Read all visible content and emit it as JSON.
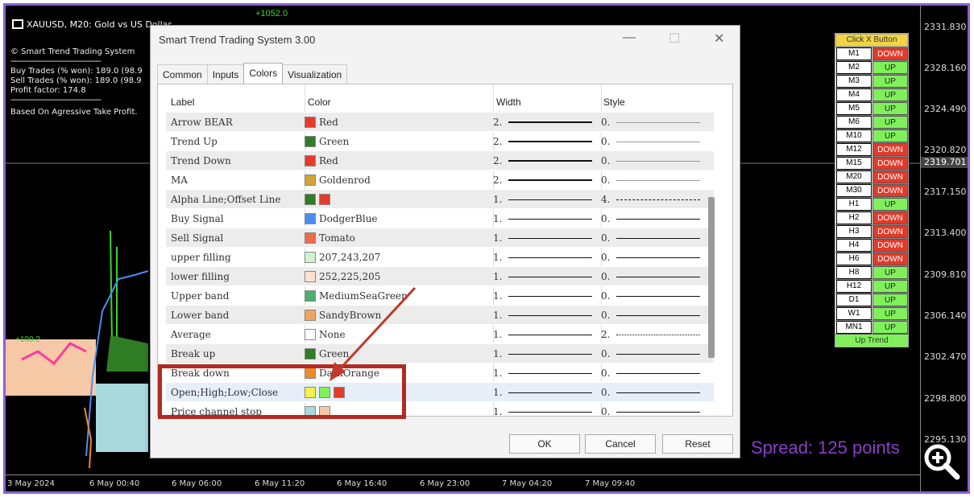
{
  "chart": {
    "symbol_title": "XAUUSD, M20:  Gold vs US Dollar",
    "top_label": "+1052.0",
    "info_lines": [
      "© Smart Trend Trading System",
      "Buy Trades (% won): 189.0 (98.9",
      "Sell Trades (% won): 189.0 (98.9",
      "Profit factor: 174.8",
      "Based On Agressive Take Profit."
    ],
    "small_label": "+100.2",
    "price_ticks": [
      "2331.830",
      "2328.160",
      "2324.490",
      "2320.820",
      "2317.150",
      "2313.400",
      "2309.810",
      "2306.140",
      "2302.470",
      "2298.800",
      "2295.130"
    ],
    "current_price": "2319.701",
    "time_ticks": [
      "3 May 2024",
      "6 May 00:40",
      "6 May 06:00",
      "6 May 11:20",
      "6 May 16:40",
      "6 May 23:00",
      "7 May 04:20",
      "7 May 09:40"
    ],
    "spread": "Spread: 125 points",
    "colors": {
      "bullish": "#3bd42a",
      "bearish": "#e33a2a",
      "band": "#a9d9dc",
      "peach": "#f6c9a6"
    }
  },
  "tf_panel": {
    "header": "Click X Button",
    "rows": [
      {
        "tf": "M1",
        "state": "DOWN"
      },
      {
        "tf": "M2",
        "state": "UP"
      },
      {
        "tf": "M3",
        "state": "UP"
      },
      {
        "tf": "M4",
        "state": "UP"
      },
      {
        "tf": "M5",
        "state": "UP"
      },
      {
        "tf": "M6",
        "state": "UP"
      },
      {
        "tf": "M10",
        "state": "UP"
      },
      {
        "tf": "M12",
        "state": "DOWN"
      },
      {
        "tf": "M15",
        "state": "DOWN"
      },
      {
        "tf": "M20",
        "state": "DOWN"
      },
      {
        "tf": "M30",
        "state": "DOWN"
      },
      {
        "tf": "H1",
        "state": "UP"
      },
      {
        "tf": "H2",
        "state": "DOWN"
      },
      {
        "tf": "H3",
        "state": "DOWN"
      },
      {
        "tf": "H4",
        "state": "DOWN"
      },
      {
        "tf": "H6",
        "state": "DOWN"
      },
      {
        "tf": "H8",
        "state": "UP"
      },
      {
        "tf": "H12",
        "state": "UP"
      },
      {
        "tf": "D1",
        "state": "UP"
      },
      {
        "tf": "W1",
        "state": "UP"
      },
      {
        "tf": "MN1",
        "state": "UP"
      }
    ],
    "footer": "Up Trend"
  },
  "dialog": {
    "title": "Smart Trend Trading System 3.00",
    "minimize": "—",
    "maximize": "☐",
    "close": "✕",
    "tabs": [
      "Common",
      "Inputs",
      "Colors",
      "Visualization"
    ],
    "active_tab": "Colors",
    "columns": {
      "label": "Label",
      "color": "Color",
      "width": "Width",
      "style": "Style"
    },
    "rows": [
      {
        "label": "Arrow BEAR",
        "swatches": [
          "#e53a2a"
        ],
        "color_name": "Red",
        "width": "2.",
        "style": "0."
      },
      {
        "label": "Trend Up",
        "swatches": [
          "#2f7d24"
        ],
        "color_name": "Green",
        "width": "2.",
        "style": "0."
      },
      {
        "label": "Trend Down",
        "swatches": [
          "#e53a2a"
        ],
        "color_name": "Red",
        "width": "2.",
        "style": "0."
      },
      {
        "label": "MA",
        "swatches": [
          "#d4a437"
        ],
        "color_name": "Goldenrod",
        "width": "2.",
        "style": "0."
      },
      {
        "label": "Alpha Line;Offset Line",
        "swatches": [
          "#2f7d24",
          "#e53a2a"
        ],
        "color_name": "",
        "width": "1.",
        "style": "4."
      },
      {
        "label": "Buy Signal",
        "swatches": [
          "#4a8ef2"
        ],
        "color_name": "DodgerBlue",
        "width": "1.",
        "style": "0."
      },
      {
        "label": "Sell Signal",
        "swatches": [
          "#ee6a4e"
        ],
        "color_name": "Tomato",
        "width": "1.",
        "style": "0."
      },
      {
        "label": "upper filling",
        "swatches": [
          "#cff3cf"
        ],
        "color_name": "207,243,207",
        "width": "1.",
        "style": "0."
      },
      {
        "label": "lower filling",
        "swatches": [
          "#fce1cd"
        ],
        "color_name": "252,225,205",
        "width": "1.",
        "style": "0."
      },
      {
        "label": "Upper band",
        "swatches": [
          "#4caf6f"
        ],
        "color_name": "MediumSeaGreen",
        "width": "1.",
        "style": "0."
      },
      {
        "label": "Lower band",
        "swatches": [
          "#efa562"
        ],
        "color_name": "SandyBrown",
        "width": "1.",
        "style": "0."
      },
      {
        "label": "Average",
        "swatches": [
          "#ffffff"
        ],
        "color_name": "None",
        "width": "1.",
        "style": "2."
      },
      {
        "label": "Break up",
        "swatches": [
          "#2f7d24"
        ],
        "color_name": "Green",
        "width": "1.",
        "style": "0."
      },
      {
        "label": "Break down",
        "swatches": [
          "#ee8a2a"
        ],
        "color_name": "DarkOrange",
        "width": "1.",
        "style": "0."
      },
      {
        "label": "Open;High;Low;Close",
        "swatches": [
          "#f6f04a",
          "#7ff05a",
          "#e53a2a"
        ],
        "color_name": "",
        "width": "1.",
        "style": "0."
      },
      {
        "label": "Price channel stop",
        "swatches": [
          "#a9d9dc",
          "#f6c9a6"
        ],
        "color_name": "",
        "width": "1.",
        "style": "0."
      }
    ],
    "buttons": {
      "ok": "OK",
      "cancel": "Cancel",
      "reset": "Reset"
    }
  }
}
